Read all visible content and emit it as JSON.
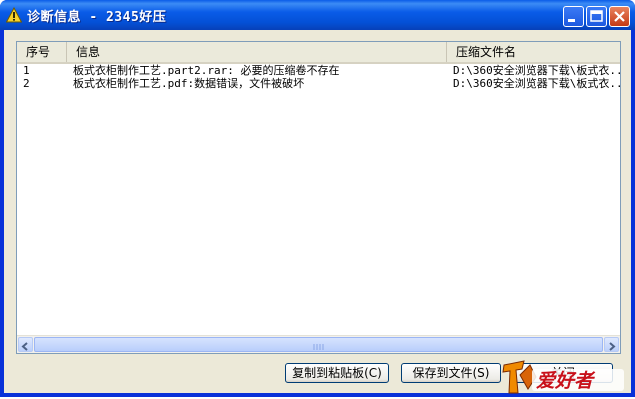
{
  "window": {
    "title": "诊断信息 - 2345好压",
    "icon": "warning-icon"
  },
  "titlebar_buttons": {
    "minimize_icon": "minimize-icon",
    "maximize_icon": "maximize-icon",
    "close_icon": "close-icon"
  },
  "list": {
    "columns": [
      "序号",
      "信息",
      "压缩文件名"
    ],
    "rows": [
      {
        "index": "1",
        "info": "板式衣柜制作工艺.part2.rar: 必要的压缩卷不存在",
        "archive": "D:\\360安全浏览器下载\\板式衣..."
      },
      {
        "index": "2",
        "info": "板式衣柜制作工艺.pdf:数据错误，文件被破坏",
        "archive": "D:\\360安全浏览器下载\\板式衣..."
      }
    ]
  },
  "buttons": {
    "copy_label": "复制到粘贴板(C)",
    "save_label": "保存到文件(S)",
    "close_label": "关闭"
  },
  "watermark": {
    "text": "爱好者",
    "colors": {
      "brand_orange": "#f08a00",
      "brand_red": "#c8101a"
    }
  },
  "colors": {
    "titlebar": "#0a5ce8",
    "client_bg": "#ece9d8",
    "list_border": "#7f9db9"
  }
}
